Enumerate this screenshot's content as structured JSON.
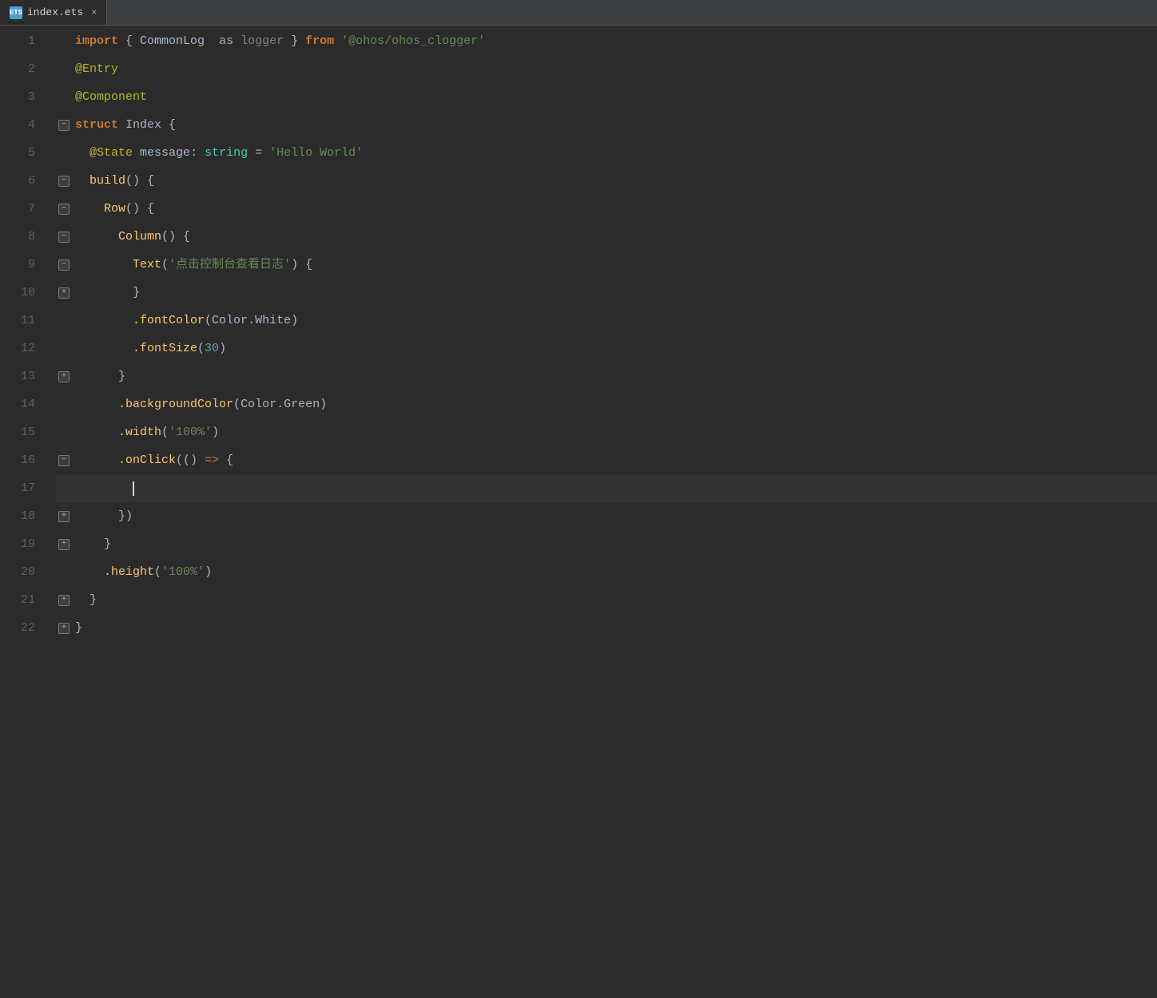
{
  "tab": {
    "icon_text": "ETS",
    "filename": "index.ets",
    "close_label": "×"
  },
  "lines": [
    {
      "num": 1,
      "gutter": "",
      "tokens": [
        {
          "t": "kw-import",
          "v": "import"
        },
        {
          "t": "plain",
          "v": " { "
        },
        {
          "t": "identifier",
          "v": "CommonLog"
        },
        {
          "t": "plain",
          "v": "  "
        },
        {
          "t": "kw-as",
          "v": "as"
        },
        {
          "t": "plain",
          "v": " "
        },
        {
          "t": "comment",
          "v": "logger"
        },
        {
          "t": "plain",
          "v": " } "
        },
        {
          "t": "kw-from",
          "v": "from"
        },
        {
          "t": "plain",
          "v": " "
        },
        {
          "t": "string",
          "v": "'@ohos/ohos_clogger'"
        }
      ]
    },
    {
      "num": 2,
      "gutter": "",
      "tokens": [
        {
          "t": "decorator",
          "v": "@Entry"
        }
      ]
    },
    {
      "num": 3,
      "gutter": "",
      "tokens": [
        {
          "t": "decorator",
          "v": "@Component"
        }
      ]
    },
    {
      "num": 4,
      "gutter": "fold-open",
      "tokens": [
        {
          "t": "kw-struct",
          "v": "struct"
        },
        {
          "t": "plain",
          "v": " "
        },
        {
          "t": "identifier",
          "v": "Index"
        },
        {
          "t": "plain",
          "v": " {"
        }
      ]
    },
    {
      "num": 5,
      "gutter": "",
      "tokens": [
        {
          "t": "plain",
          "v": "  "
        },
        {
          "t": "state-decorator",
          "v": "@State"
        },
        {
          "t": "plain",
          "v": " "
        },
        {
          "t": "identifier",
          "v": "message"
        },
        {
          "t": "plain",
          "v": ": "
        },
        {
          "t": "param-type",
          "v": "string"
        },
        {
          "t": "plain",
          "v": " = "
        },
        {
          "t": "string-single",
          "v": "'Hello World'"
        }
      ]
    },
    {
      "num": 6,
      "gutter": "fold-open",
      "tokens": [
        {
          "t": "plain",
          "v": "  "
        },
        {
          "t": "method",
          "v": "build"
        },
        {
          "t": "plain",
          "v": "() {"
        }
      ]
    },
    {
      "num": 7,
      "gutter": "fold-open",
      "tokens": [
        {
          "t": "plain",
          "v": "    "
        },
        {
          "t": "method",
          "v": "Row"
        },
        {
          "t": "plain",
          "v": "() {"
        }
      ]
    },
    {
      "num": 8,
      "gutter": "fold-open",
      "tokens": [
        {
          "t": "plain",
          "v": "      "
        },
        {
          "t": "method",
          "v": "Column"
        },
        {
          "t": "plain",
          "v": "() {"
        }
      ]
    },
    {
      "num": 9,
      "gutter": "fold-open",
      "tokens": [
        {
          "t": "plain",
          "v": "        "
        },
        {
          "t": "method",
          "v": "Text"
        },
        {
          "t": "plain",
          "v": "("
        },
        {
          "t": "chinese-string",
          "v": "'点击控制台查看日志'"
        },
        {
          "t": "plain",
          "v": ") {"
        }
      ]
    },
    {
      "num": 10,
      "gutter": "fold-close",
      "tokens": [
        {
          "t": "plain",
          "v": "        }"
        }
      ]
    },
    {
      "num": 11,
      "gutter": "",
      "tokens": [
        {
          "t": "plain",
          "v": "        "
        },
        {
          "t": "method",
          "v": ".fontColor"
        },
        {
          "t": "plain",
          "v": "("
        },
        {
          "t": "identifier",
          "v": "Color"
        },
        {
          "t": "plain",
          "v": "."
        },
        {
          "t": "identifier",
          "v": "White"
        },
        {
          "t": "plain",
          "v": ")"
        }
      ]
    },
    {
      "num": 12,
      "gutter": "",
      "tokens": [
        {
          "t": "plain",
          "v": "        "
        },
        {
          "t": "method",
          "v": ".fontSize"
        },
        {
          "t": "plain",
          "v": "("
        },
        {
          "t": "number",
          "v": "30"
        },
        {
          "t": "plain",
          "v": ")"
        }
      ]
    },
    {
      "num": 13,
      "gutter": "fold-close",
      "tokens": [
        {
          "t": "plain",
          "v": "      }"
        }
      ]
    },
    {
      "num": 14,
      "gutter": "",
      "tokens": [
        {
          "t": "plain",
          "v": "      "
        },
        {
          "t": "method",
          "v": ".backgroundColor"
        },
        {
          "t": "plain",
          "v": "("
        },
        {
          "t": "identifier",
          "v": "Color"
        },
        {
          "t": "plain",
          "v": "."
        },
        {
          "t": "identifier",
          "v": "Green"
        },
        {
          "t": "plain",
          "v": ")"
        }
      ]
    },
    {
      "num": 15,
      "gutter": "",
      "tokens": [
        {
          "t": "plain",
          "v": "      "
        },
        {
          "t": "method",
          "v": ".width"
        },
        {
          "t": "plain",
          "v": "("
        },
        {
          "t": "string-single",
          "v": "'100%'"
        },
        {
          "t": "plain",
          "v": ")"
        }
      ]
    },
    {
      "num": 16,
      "gutter": "fold-open",
      "tokens": [
        {
          "t": "plain",
          "v": "      "
        },
        {
          "t": "method",
          "v": ".onClick"
        },
        {
          "t": "plain",
          "v": "(("
        },
        {
          "t": "plain",
          "v": ") "
        },
        {
          "t": "arrow",
          "v": "=>"
        },
        {
          "t": "plain",
          "v": " {"
        }
      ]
    },
    {
      "num": 17,
      "gutter": "",
      "cursor": true,
      "tokens": [
        {
          "t": "plain",
          "v": "        "
        }
      ]
    },
    {
      "num": 18,
      "gutter": "fold-close",
      "tokens": [
        {
          "t": "plain",
          "v": "      })"
        }
      ]
    },
    {
      "num": 19,
      "gutter": "fold-close",
      "tokens": [
        {
          "t": "plain",
          "v": "    }"
        }
      ]
    },
    {
      "num": 20,
      "gutter": "",
      "tokens": [
        {
          "t": "plain",
          "v": "    "
        },
        {
          "t": "method",
          "v": ".height"
        },
        {
          "t": "plain",
          "v": "("
        },
        {
          "t": "string-single",
          "v": "'100%'"
        },
        {
          "t": "plain",
          "v": ")"
        }
      ]
    },
    {
      "num": 21,
      "gutter": "fold-close",
      "tokens": [
        {
          "t": "plain",
          "v": "  }"
        }
      ]
    },
    {
      "num": 22,
      "gutter": "fold-close",
      "tokens": [
        {
          "t": "plain",
          "v": "}"
        }
      ]
    }
  ]
}
